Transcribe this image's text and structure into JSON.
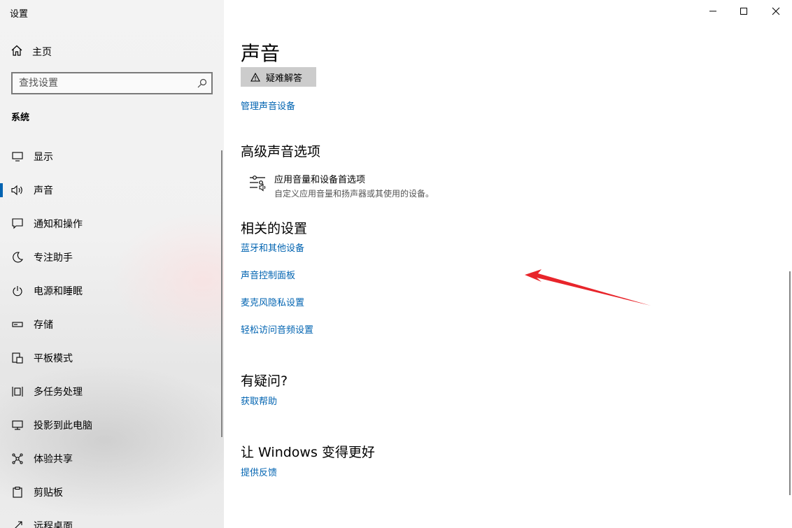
{
  "window": {
    "title": "设置"
  },
  "sidebar": {
    "home_label": "主页",
    "search_placeholder": "查找设置",
    "section_label": "系统",
    "items": [
      {
        "label": "显示",
        "icon": "monitor-icon"
      },
      {
        "label": "声音",
        "icon": "speaker-icon",
        "active": true
      },
      {
        "label": "通知和操作",
        "icon": "notification-icon"
      },
      {
        "label": "专注助手",
        "icon": "moon-icon"
      },
      {
        "label": "电源和睡眠",
        "icon": "power-icon"
      },
      {
        "label": "存储",
        "icon": "storage-icon"
      },
      {
        "label": "平板模式",
        "icon": "tablet-icon"
      },
      {
        "label": "多任务处理",
        "icon": "multitask-icon"
      },
      {
        "label": "投影到此电脑",
        "icon": "project-icon"
      },
      {
        "label": "体验共享",
        "icon": "share-icon"
      },
      {
        "label": "剪贴板",
        "icon": "clipboard-icon"
      },
      {
        "label": "远程桌面",
        "icon": "remote-desktop-icon"
      }
    ]
  },
  "main": {
    "title": "声音",
    "troubleshoot_label": "疑难解答",
    "manage_devices_link": "管理声音设备",
    "advanced": {
      "heading": "高级声音选项",
      "option_title": "应用音量和设备首选项",
      "option_desc": "自定义应用音量和扬声器或其使用的设备。"
    },
    "related": {
      "heading": "相关的设置",
      "links": [
        "蓝牙和其他设备",
        "声音控制面板",
        "麦克风隐私设置",
        "轻松访问音频设置"
      ]
    },
    "questions": {
      "heading": "有疑问?",
      "link": "获取帮助"
    },
    "improve": {
      "heading": "让 Windows 变得更好",
      "link": "提供反馈"
    }
  },
  "accent_color": "#0063b1",
  "annotation_color": "#e8252b"
}
